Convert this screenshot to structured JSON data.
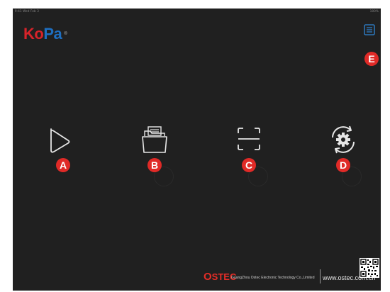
{
  "status_bar": {
    "left_text": "9:41 Wed Feb 3",
    "right_text": "100%"
  },
  "logo": {
    "part1": "Ko",
    "part2": "Pa",
    "registered": "®"
  },
  "markers": {
    "a": "A",
    "b": "B",
    "c": "C",
    "d": "D",
    "e": "E"
  },
  "footer": {
    "brand_first": "O",
    "brand_rest": "STEC",
    "company": "GuangZhou Ostec Electronic Technology Co.,Limited",
    "url": "www.ostec.com.cn"
  },
  "colors": {
    "background": "#202020",
    "marker_red": "#e02a27",
    "icon_stroke": "#e6e6e6",
    "logo_red": "#d8232a",
    "logo_blue": "#1e6fc1",
    "menu_icon": "#2f86d6"
  },
  "icons": {
    "menu": "list-menu-icon",
    "play": "play-icon",
    "folder": "folder-icon",
    "scan": "scan-icon",
    "settings": "settings-gear-icon"
  }
}
